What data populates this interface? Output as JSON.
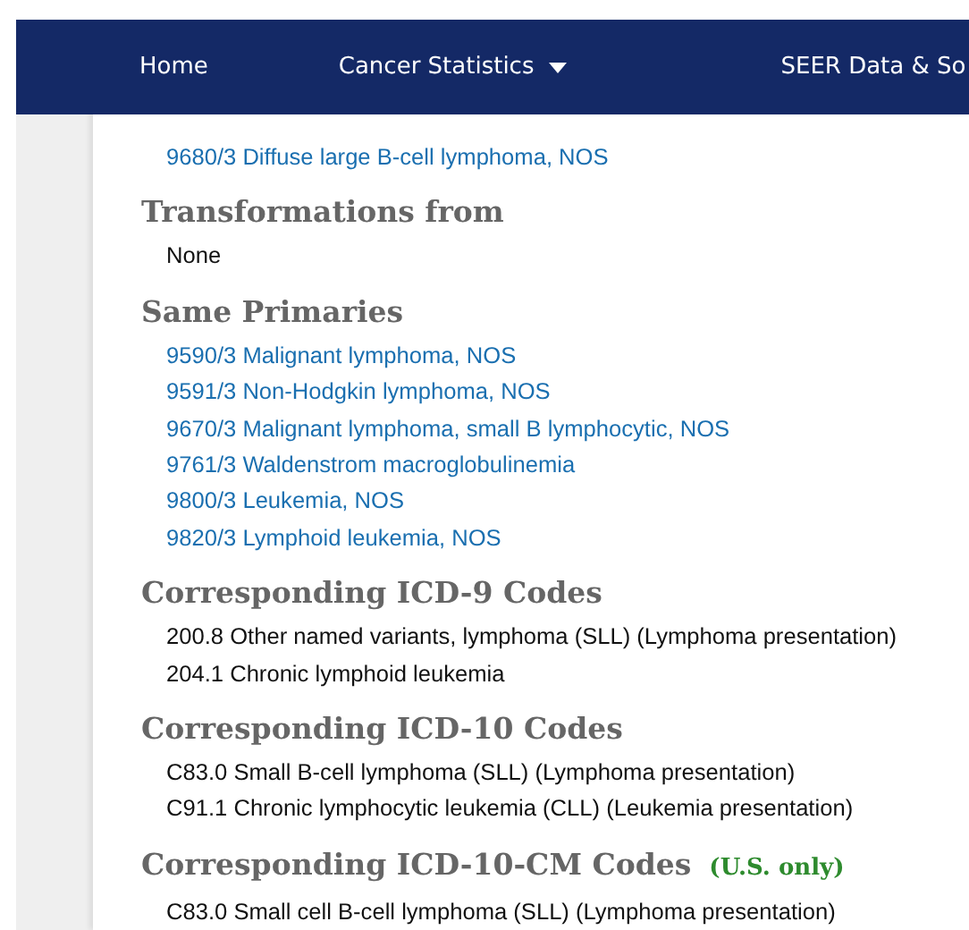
{
  "nav": {
    "items": [
      {
        "label": "Home",
        "dropdown": false
      },
      {
        "label": "Cancer Statistics",
        "dropdown": true
      },
      {
        "label": "SEER Data & So",
        "dropdown": false
      }
    ]
  },
  "sections": [
    {
      "items": [
        {
          "kind": "link",
          "text": "9680/3 Diffuse large B-cell lymphoma, NOS"
        }
      ]
    },
    {
      "title": "Transformations from",
      "items": [
        {
          "kind": "plain",
          "text": "None"
        }
      ]
    },
    {
      "title": "Same Primaries",
      "items": [
        {
          "kind": "link",
          "text": "9590/3 Malignant lymphoma, NOS"
        },
        {
          "kind": "link",
          "text": "9591/3 Non-Hodgkin lymphoma, NOS"
        },
        {
          "kind": "link",
          "text": "9670/3 Malignant lymphoma, small B lymphocytic, NOS"
        },
        {
          "kind": "link",
          "text": "9761/3 Waldenstrom macroglobulinemia"
        },
        {
          "kind": "link",
          "text": "9800/3 Leukemia, NOS"
        },
        {
          "kind": "link",
          "text": "9820/3 Lymphoid leukemia, NOS"
        }
      ]
    },
    {
      "title": "Corresponding ICD-9 Codes",
      "items": [
        {
          "kind": "plain",
          "text": "200.8 Other named variants, lymphoma (SLL) (Lymphoma presentation)"
        },
        {
          "kind": "plain",
          "text": "204.1 Chronic lymphoid leukemia"
        }
      ]
    },
    {
      "title": "Corresponding ICD-10 Codes",
      "items": [
        {
          "kind": "plain",
          "text": "C83.0 Small B-cell lymphoma (SLL) (Lymphoma presentation)"
        },
        {
          "kind": "plain",
          "text": "C91.1 Chronic lymphocytic leukemia (CLL) (Leukemia presentation)"
        }
      ]
    },
    {
      "title": "Corresponding ICD-10-CM Codes",
      "note": "(U.S. only)",
      "items": [
        {
          "kind": "plain",
          "text": "C83.0 Small cell B-cell lymphoma (SLL) (Lymphoma presentation)"
        }
      ]
    }
  ]
}
